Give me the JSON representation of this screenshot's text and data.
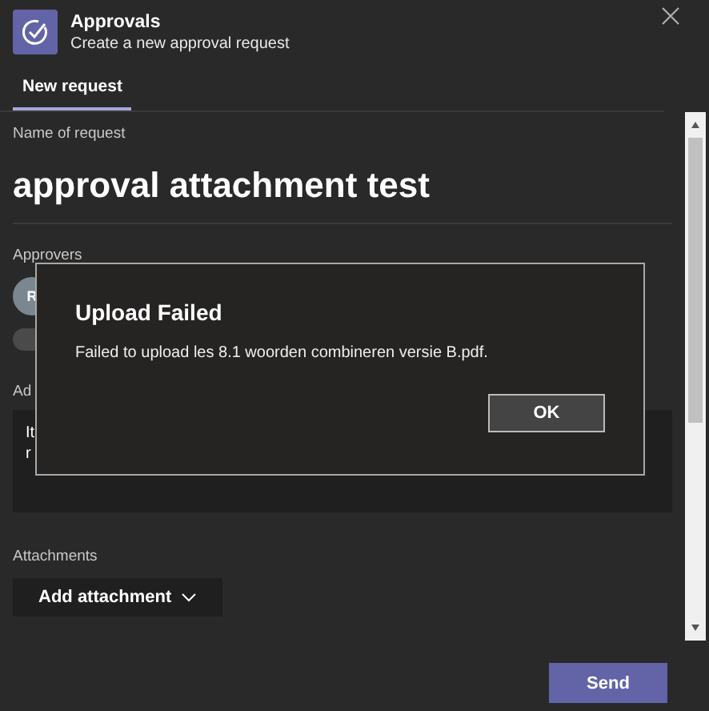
{
  "header": {
    "title": "Approvals",
    "subtitle": "Create a new approval request"
  },
  "tabs": [
    {
      "label": "New request",
      "selected": true
    }
  ],
  "form": {
    "name_label": "Name of request",
    "name_value": "approval attachment test",
    "approvers_label": "Approvers",
    "approver_initials": "R",
    "details_label": "Ad",
    "details_value": "It\nr",
    "attachments_label": "Attachments",
    "add_attachment": "Add attachment"
  },
  "send_button": "Send",
  "dialog": {
    "title": "Upload Failed",
    "message": "Failed to upload les 8.1 woorden combineren versie B.pdf.",
    "button": "OK"
  }
}
